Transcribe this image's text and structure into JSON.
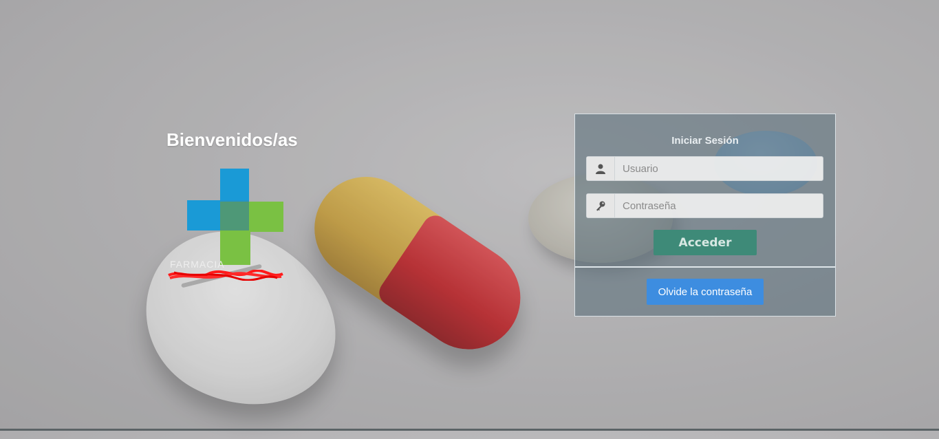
{
  "welcome": {
    "title": "Bienvenidos/as"
  },
  "logo": {
    "text": "FARMACIA"
  },
  "login": {
    "title": "Iniciar Sesión",
    "user_placeholder": "Usuario",
    "password_placeholder": "Contraseña",
    "submit_label": "Acceder",
    "forgot_label": "Olvide la contraseña"
  },
  "colors": {
    "submit_button": "#3e8a78",
    "forgot_button": "#3d8de0",
    "logo_blue": "#1a9ad6",
    "logo_green": "#7ac143"
  },
  "icons": {
    "user_field": "user-icon",
    "password_field": "key-icon"
  }
}
